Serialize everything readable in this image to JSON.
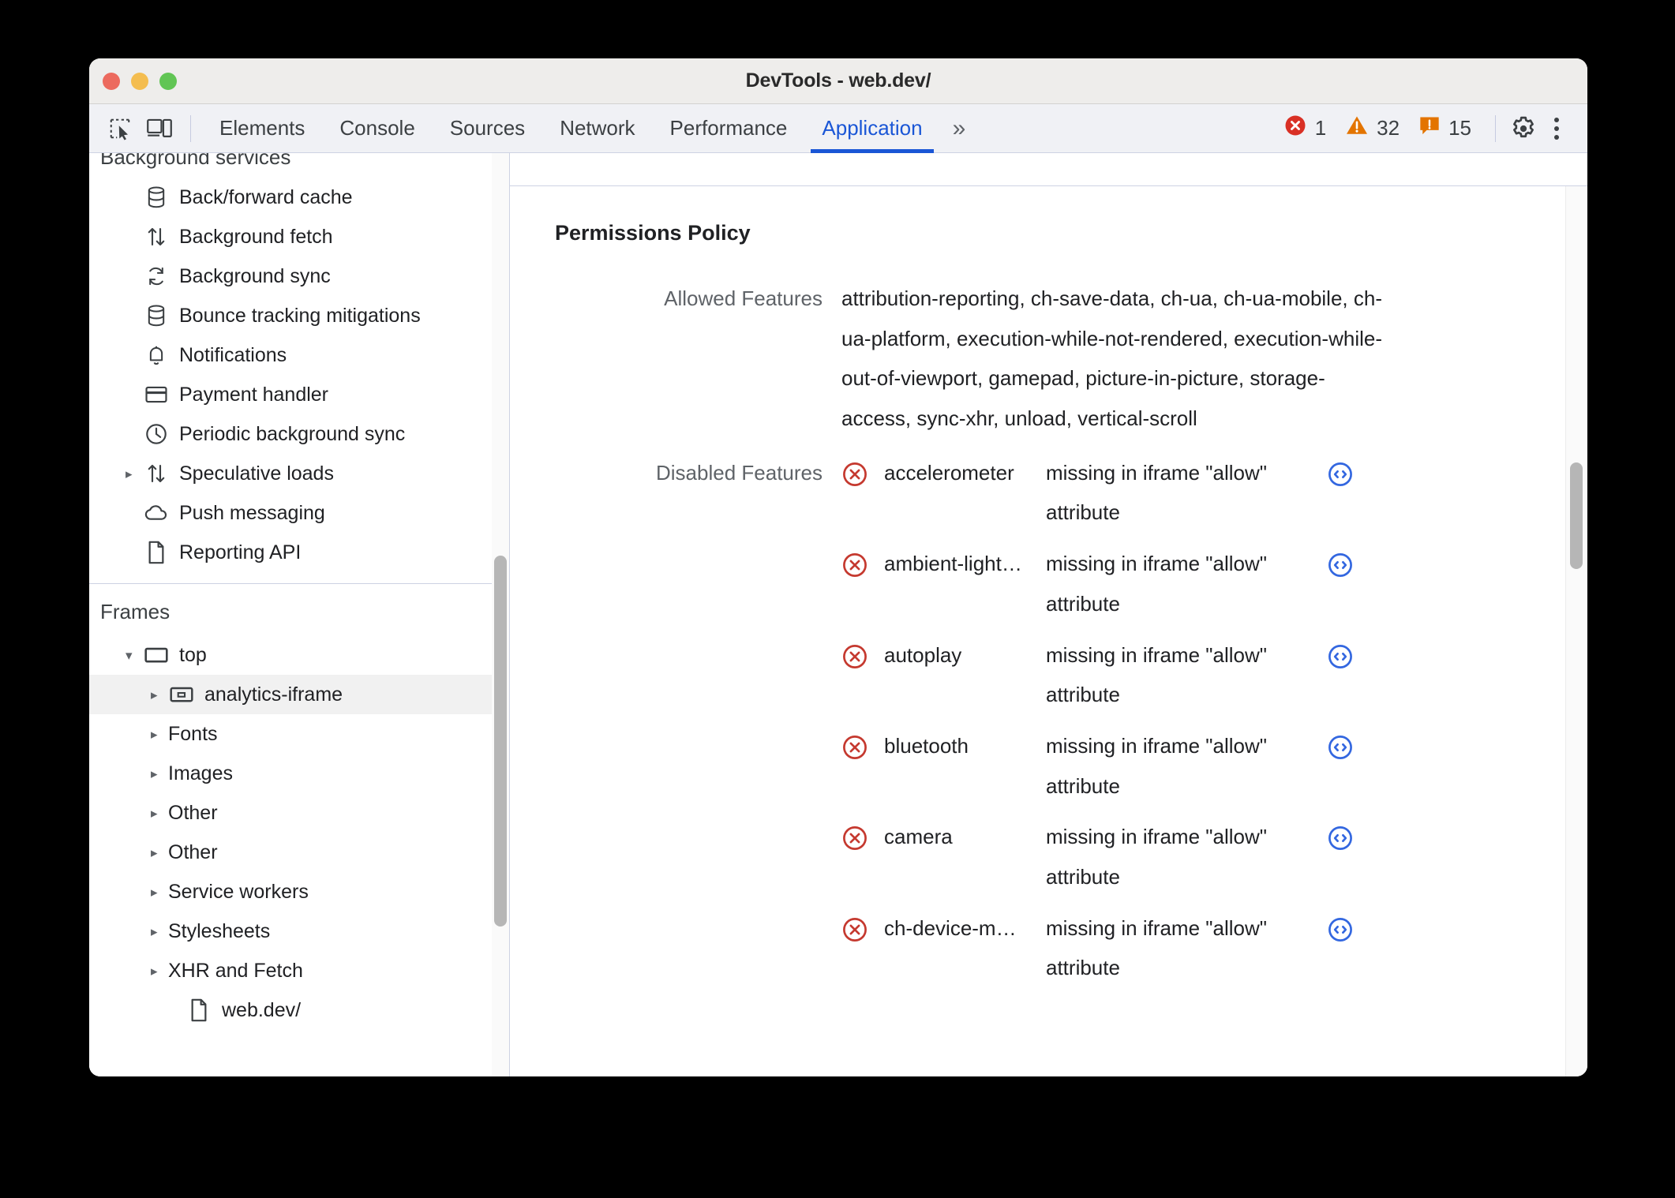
{
  "window": {
    "title": "DevTools - web.dev/",
    "traffic_lights": [
      {
        "name": "close",
        "color": "#ec6a5e"
      },
      {
        "name": "minimize",
        "color": "#f4bd4f"
      },
      {
        "name": "maximize",
        "color": "#61c554"
      }
    ]
  },
  "toolbar": {
    "inspect_icon": "inspect-element-icon",
    "device_icon": "device-toolbar-icon",
    "tabs": [
      {
        "label": "Elements",
        "active": false
      },
      {
        "label": "Console",
        "active": false
      },
      {
        "label": "Sources",
        "active": false
      },
      {
        "label": "Network",
        "active": false
      },
      {
        "label": "Performance",
        "active": false
      },
      {
        "label": "Application",
        "active": true
      }
    ],
    "more_tabs": "»",
    "counters": [
      {
        "icon": "error-icon",
        "count": "1",
        "color": "#d93025"
      },
      {
        "icon": "warning-icon",
        "count": "32",
        "color": "#e37400"
      },
      {
        "icon": "issue-icon",
        "count": "15",
        "color": "#e37400"
      }
    ],
    "settings_icon": "gear-icon",
    "kebab_icon": "more-options-icon",
    "accent": "#1a56d6"
  },
  "sidebar": {
    "sections": [
      {
        "title": "Background services",
        "clipped": true,
        "items": [
          {
            "label": "Back/forward cache",
            "icon": "database-icon",
            "caret": "none",
            "indent": 1,
            "selected": false
          },
          {
            "label": "Background fetch",
            "icon": "arrows-updown-icon",
            "caret": "none",
            "indent": 1,
            "selected": false
          },
          {
            "label": "Background sync",
            "icon": "sync-icon",
            "caret": "none",
            "indent": 1,
            "selected": false
          },
          {
            "label": "Bounce tracking mitigations",
            "icon": "database-icon",
            "caret": "none",
            "indent": 1,
            "selected": false
          },
          {
            "label": "Notifications",
            "icon": "bell-icon",
            "caret": "none",
            "indent": 1,
            "selected": false
          },
          {
            "label": "Payment handler",
            "icon": "credit-card-icon",
            "caret": "none",
            "indent": 1,
            "selected": false
          },
          {
            "label": "Periodic background sync",
            "icon": "clock-icon",
            "caret": "none",
            "indent": 1,
            "selected": false
          },
          {
            "label": "Speculative loads",
            "icon": "arrows-updown-icon",
            "caret": "closed",
            "indent": 1,
            "selected": false
          },
          {
            "label": "Push messaging",
            "icon": "cloud-icon",
            "caret": "none",
            "indent": 1,
            "selected": false
          },
          {
            "label": "Reporting API",
            "icon": "document-icon",
            "caret": "none",
            "indent": 1,
            "selected": false
          }
        ]
      },
      {
        "title": "Frames",
        "clipped": false,
        "items": [
          {
            "label": "top",
            "icon": "frame-icon",
            "caret": "open",
            "indent": 1,
            "selected": false
          },
          {
            "label": "analytics-iframe",
            "icon": "iframe-icon",
            "caret": "closed",
            "indent": 2,
            "selected": true
          },
          {
            "label": "Fonts",
            "icon": "none",
            "caret": "closed",
            "indent": 2,
            "selected": false
          },
          {
            "label": "Images",
            "icon": "none",
            "caret": "closed",
            "indent": 2,
            "selected": false
          },
          {
            "label": "Other",
            "icon": "none",
            "caret": "closed",
            "indent": 2,
            "selected": false
          },
          {
            "label": "Other",
            "icon": "none",
            "caret": "closed",
            "indent": 2,
            "selected": false
          },
          {
            "label": "Service workers",
            "icon": "none",
            "caret": "closed",
            "indent": 2,
            "selected": false
          },
          {
            "label": "Stylesheets",
            "icon": "none",
            "caret": "closed",
            "indent": 2,
            "selected": false
          },
          {
            "label": "XHR and Fetch",
            "icon": "none",
            "caret": "closed",
            "indent": 2,
            "selected": false
          },
          {
            "label": "web.dev/",
            "icon": "document-icon",
            "caret": "none",
            "indent": 3,
            "selected": false
          }
        ]
      }
    ]
  },
  "main": {
    "panel_title": "Permissions Policy",
    "allowed": {
      "key": "Allowed Features",
      "value": "attribution-reporting, ch-save-data, ch-ua, ch-ua-mobile, ch-ua-platform, execution-while-not-rendered, execution-while-out-of-viewport, gamepad, picture-in-picture, storage-access, sync-xhr, unload, vertical-scroll"
    },
    "disabled": {
      "key": "Disabled Features",
      "reason_icon": "circle-x-icon",
      "link_icon": "code-brackets-icon",
      "reason_color": "#c5392f",
      "link_color": "#3367e0",
      "rows": [
        {
          "name": "accelerometer",
          "reason": "missing in iframe \"allow\" attribute"
        },
        {
          "name": "ambient-light…",
          "reason": "missing in iframe \"allow\" attribute"
        },
        {
          "name": "autoplay",
          "reason": "missing in iframe \"allow\" attribute"
        },
        {
          "name": "bluetooth",
          "reason": "missing in iframe \"allow\" attribute"
        },
        {
          "name": "camera",
          "reason": "missing in iframe \"allow\" attribute"
        },
        {
          "name": "ch-device-m…",
          "reason": "missing in iframe \"allow\" attribute"
        }
      ]
    }
  }
}
